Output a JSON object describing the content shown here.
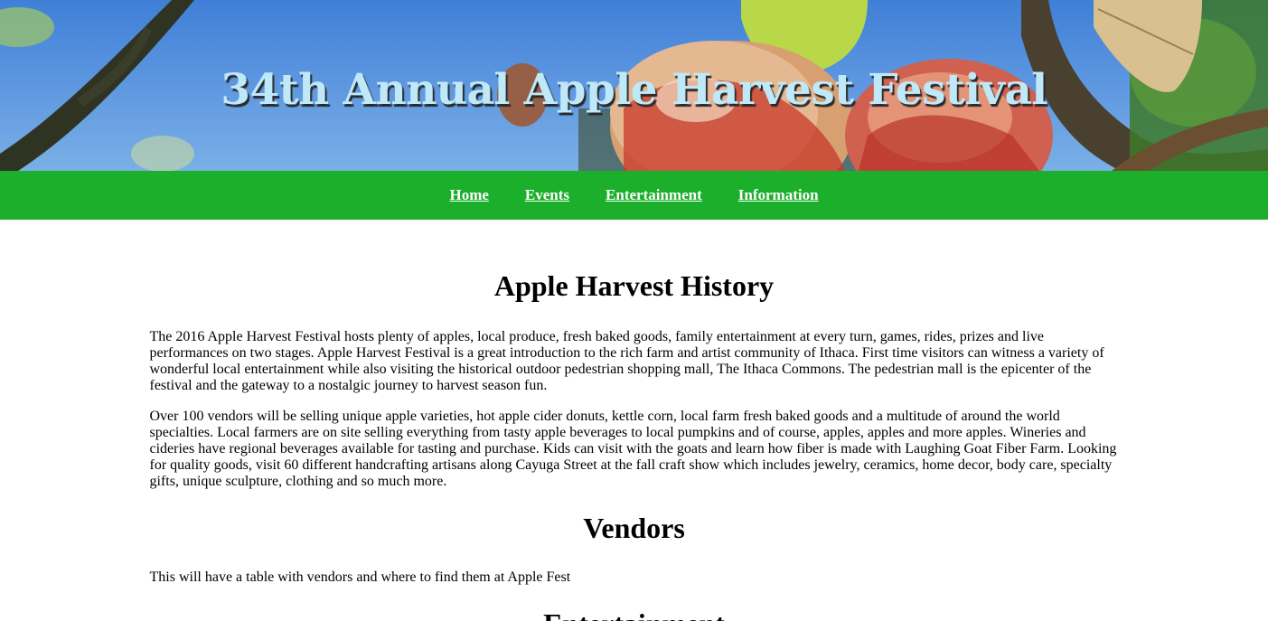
{
  "hero": {
    "title": "34th Annual Apple Harvest Festival"
  },
  "nav": {
    "items": [
      "Home",
      "Events",
      "Entertainment",
      "Information"
    ]
  },
  "sections": {
    "history": {
      "heading": "Apple Harvest History",
      "paragraphs": [
        "The 2016 Apple Harvest Festival hosts plenty of apples, local produce, fresh baked goods, family entertainment at every turn, games, rides, prizes and live performances on two stages. Apple Harvest Festival is a great introduction to the rich farm and artist community of Ithaca. First time visitors can witness a variety of wonderful local entertainment while also visiting the historical outdoor pedestrian shopping mall, The Ithaca Commons. The pedestrian mall is the epicenter of the festival and the gateway to a nostalgic journey to harvest season fun.",
        "Over 100 vendors will be selling unique apple varieties, hot apple cider donuts, kettle corn, local farm fresh baked goods and a multitude of around the world specialties. Local farmers are on site selling everything from tasty apple beverages to local pumpkins and of course, apples, apples and more apples. Wineries and cideries have regional beverages available for tasting and purchase. Kids can visit with the goats and learn how fiber is made with Laughing Goat Fiber Farm. Looking for quality goods, visit 60 different handcrafting artisans along Cayuga Street at the fall craft show which includes jewelry, ceramics, home decor, body care, specialty gifts, unique sculpture, clothing and so much more."
      ]
    },
    "vendors": {
      "heading": "Vendors",
      "text": "This will have a table with vendors and where to find them at Apple Fest"
    },
    "entertainment": {
      "heading": "Entertainment"
    }
  },
  "colors": {
    "nav_background": "#1caf2c",
    "hero_title": "#bfe8f8",
    "sky": "#4a88da"
  },
  "hero_image": {
    "icon": "apple-tree-photo"
  }
}
